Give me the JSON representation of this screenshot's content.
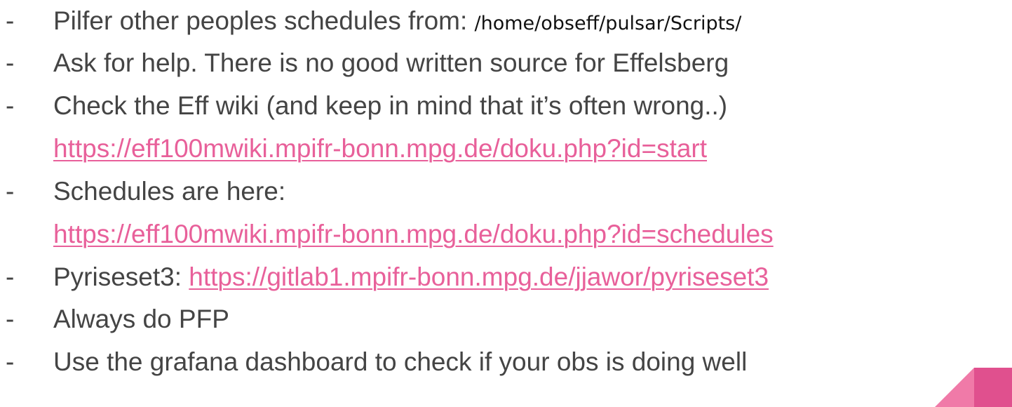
{
  "bullets": [
    {
      "dash": "-",
      "text": "Pilfer other peoples schedules from: ",
      "path": "/home/obseff/pulsar/Scripts/"
    },
    {
      "dash": "-",
      "text": "Ask for help. There is no good written source for Effelsberg"
    },
    {
      "dash": "-",
      "text": "Check the Eff wiki (and keep in mind that it’s often wrong..)",
      "link": "https://eff100mwiki.mpifr-bonn.mpg.de/doku.php?id=start"
    },
    {
      "dash": "-",
      "text": "Schedules are here:",
      "link": "https://eff100mwiki.mpifr-bonn.mpg.de/doku.php?id=schedules"
    },
    {
      "dash": "-",
      "text": "Pyriseset3: ",
      "link": "https://gitlab1.mpifr-bonn.mpg.de/jjawor/pyriseset3"
    },
    {
      "dash": "-",
      "text": "Always do PFP"
    },
    {
      "dash": "-",
      "text": "Use the grafana dashboard to check if your obs is doing well"
    }
  ],
  "colors": {
    "text": "#444444",
    "link": "#e8609a",
    "path": "#111111",
    "accent_light": "#f07aa8",
    "accent_dark": "#e0508e"
  }
}
